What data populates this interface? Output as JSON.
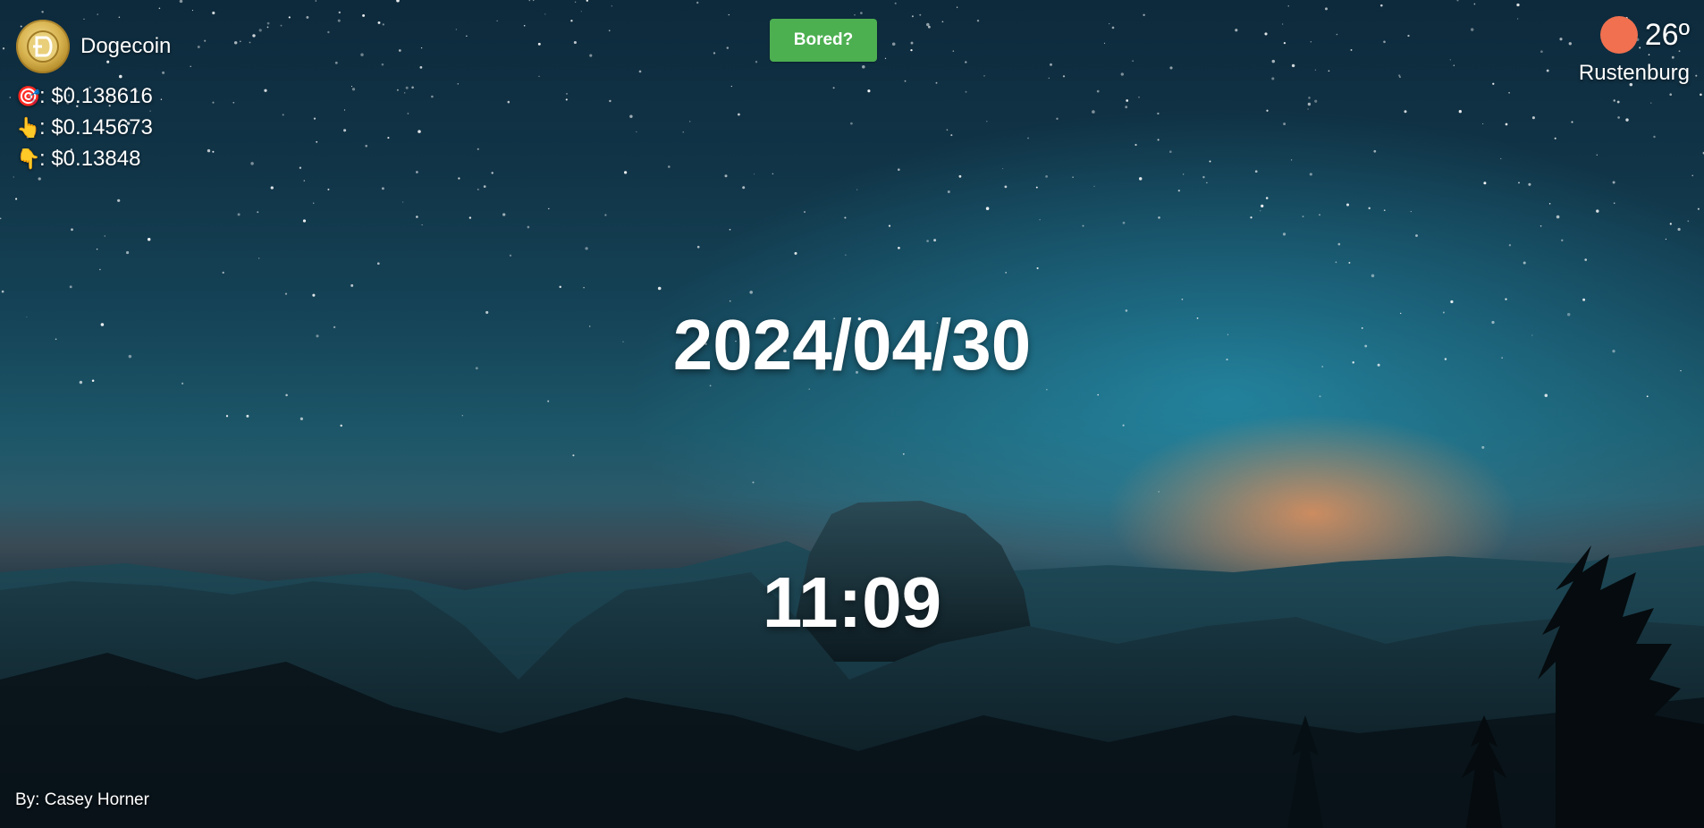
{
  "crypto": {
    "name": "Dogecoin",
    "logo_icon": "dogecoin-logo-icon",
    "prices": [
      {
        "icon": "target-icon",
        "emoji": "🎯",
        "text": ": $0.138616"
      },
      {
        "icon": "pointing-up-icon",
        "emoji": "👆",
        "text": ": $0.145673"
      },
      {
        "icon": "pointing-down-icon",
        "emoji": "👇",
        "text": ": $0.13848"
      }
    ]
  },
  "bored_button": {
    "label": "Bored?",
    "color": "#4caf50"
  },
  "weather": {
    "icon": "sun-icon",
    "icon_color": "#f0704f",
    "temperature": "26º",
    "city": "Rustenburg"
  },
  "date": "2024/04/30",
  "time": "11:09",
  "credit": "By: Casey Horner"
}
